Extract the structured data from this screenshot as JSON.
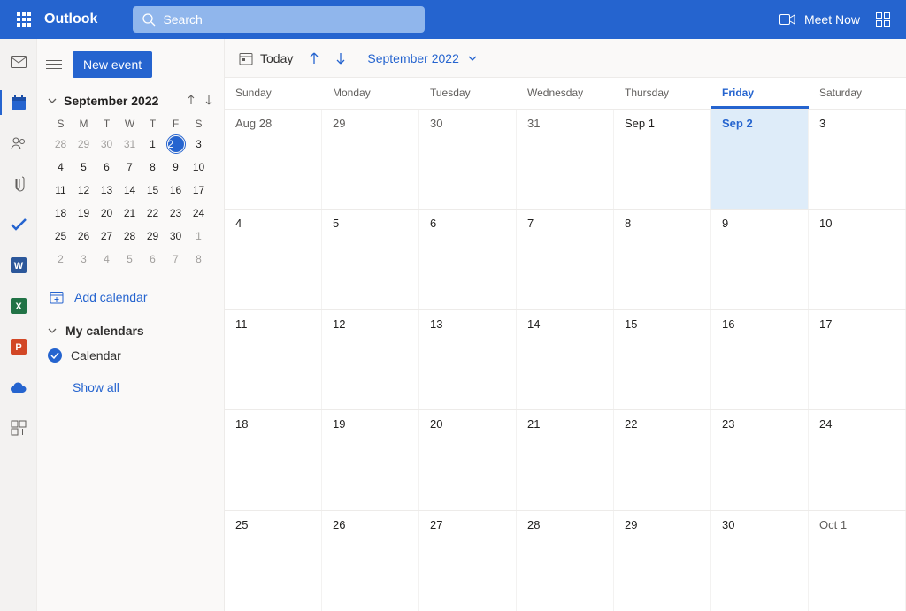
{
  "header": {
    "brand": "Outlook",
    "search_placeholder": "Search",
    "meet_now": "Meet Now"
  },
  "sidebar": {
    "new_event": "New event",
    "mini_month_label": "September 2022",
    "mini_dow": [
      "S",
      "M",
      "T",
      "W",
      "T",
      "F",
      "S"
    ],
    "mini_weeks": [
      [
        {
          "n": "28",
          "m": true
        },
        {
          "n": "29",
          "m": true
        },
        {
          "n": "30",
          "m": true
        },
        {
          "n": "31",
          "m": true
        },
        {
          "n": "1"
        },
        {
          "n": "2",
          "today": true
        },
        {
          "n": "3"
        }
      ],
      [
        {
          "n": "4"
        },
        {
          "n": "5"
        },
        {
          "n": "6"
        },
        {
          "n": "7"
        },
        {
          "n": "8"
        },
        {
          "n": "9"
        },
        {
          "n": "10"
        }
      ],
      [
        {
          "n": "11"
        },
        {
          "n": "12"
        },
        {
          "n": "13"
        },
        {
          "n": "14"
        },
        {
          "n": "15"
        },
        {
          "n": "16"
        },
        {
          "n": "17"
        }
      ],
      [
        {
          "n": "18"
        },
        {
          "n": "19"
        },
        {
          "n": "20"
        },
        {
          "n": "21"
        },
        {
          "n": "22"
        },
        {
          "n": "23"
        },
        {
          "n": "24"
        }
      ],
      [
        {
          "n": "25"
        },
        {
          "n": "26"
        },
        {
          "n": "27"
        },
        {
          "n": "28"
        },
        {
          "n": "29"
        },
        {
          "n": "30"
        },
        {
          "n": "1",
          "m": true
        }
      ],
      [
        {
          "n": "2",
          "m": true
        },
        {
          "n": "3",
          "m": true
        },
        {
          "n": "4",
          "m": true
        },
        {
          "n": "5",
          "m": true
        },
        {
          "n": "6",
          "m": true
        },
        {
          "n": "7",
          "m": true
        },
        {
          "n": "8",
          "m": true
        }
      ]
    ],
    "add_calendar": "Add calendar",
    "my_calendars": "My calendars",
    "calendar_item": "Calendar",
    "show_all": "Show all"
  },
  "toolbar": {
    "today": "Today",
    "month_label": "September 2022"
  },
  "calendar": {
    "dow": [
      "Sunday",
      "Monday",
      "Tuesday",
      "Wednesday",
      "Thursday",
      "Friday",
      "Saturday"
    ],
    "today_col": 5,
    "weeks": [
      [
        {
          "l": "Aug 28"
        },
        {
          "l": "29"
        },
        {
          "l": "30"
        },
        {
          "l": "31"
        },
        {
          "l": "Sep 1",
          "first": true
        },
        {
          "l": "Sep 2",
          "today": true
        },
        {
          "l": "3",
          "cur": true
        }
      ],
      [
        {
          "l": "4",
          "cur": true
        },
        {
          "l": "5",
          "cur": true
        },
        {
          "l": "6",
          "cur": true
        },
        {
          "l": "7",
          "cur": true
        },
        {
          "l": "8",
          "cur": true
        },
        {
          "l": "9",
          "cur": true
        },
        {
          "l": "10",
          "cur": true
        }
      ],
      [
        {
          "l": "11",
          "cur": true
        },
        {
          "l": "12",
          "cur": true
        },
        {
          "l": "13",
          "cur": true
        },
        {
          "l": "14",
          "cur": true
        },
        {
          "l": "15",
          "cur": true
        },
        {
          "l": "16",
          "cur": true
        },
        {
          "l": "17",
          "cur": true
        }
      ],
      [
        {
          "l": "18",
          "cur": true
        },
        {
          "l": "19",
          "cur": true
        },
        {
          "l": "20",
          "cur": true
        },
        {
          "l": "21",
          "cur": true
        },
        {
          "l": "22",
          "cur": true
        },
        {
          "l": "23",
          "cur": true
        },
        {
          "l": "24",
          "cur": true
        }
      ],
      [
        {
          "l": "25",
          "cur": true
        },
        {
          "l": "26",
          "cur": true
        },
        {
          "l": "27",
          "cur": true
        },
        {
          "l": "28",
          "cur": true
        },
        {
          "l": "29",
          "cur": true
        },
        {
          "l": "30",
          "cur": true
        },
        {
          "l": "Oct 1"
        }
      ]
    ]
  }
}
